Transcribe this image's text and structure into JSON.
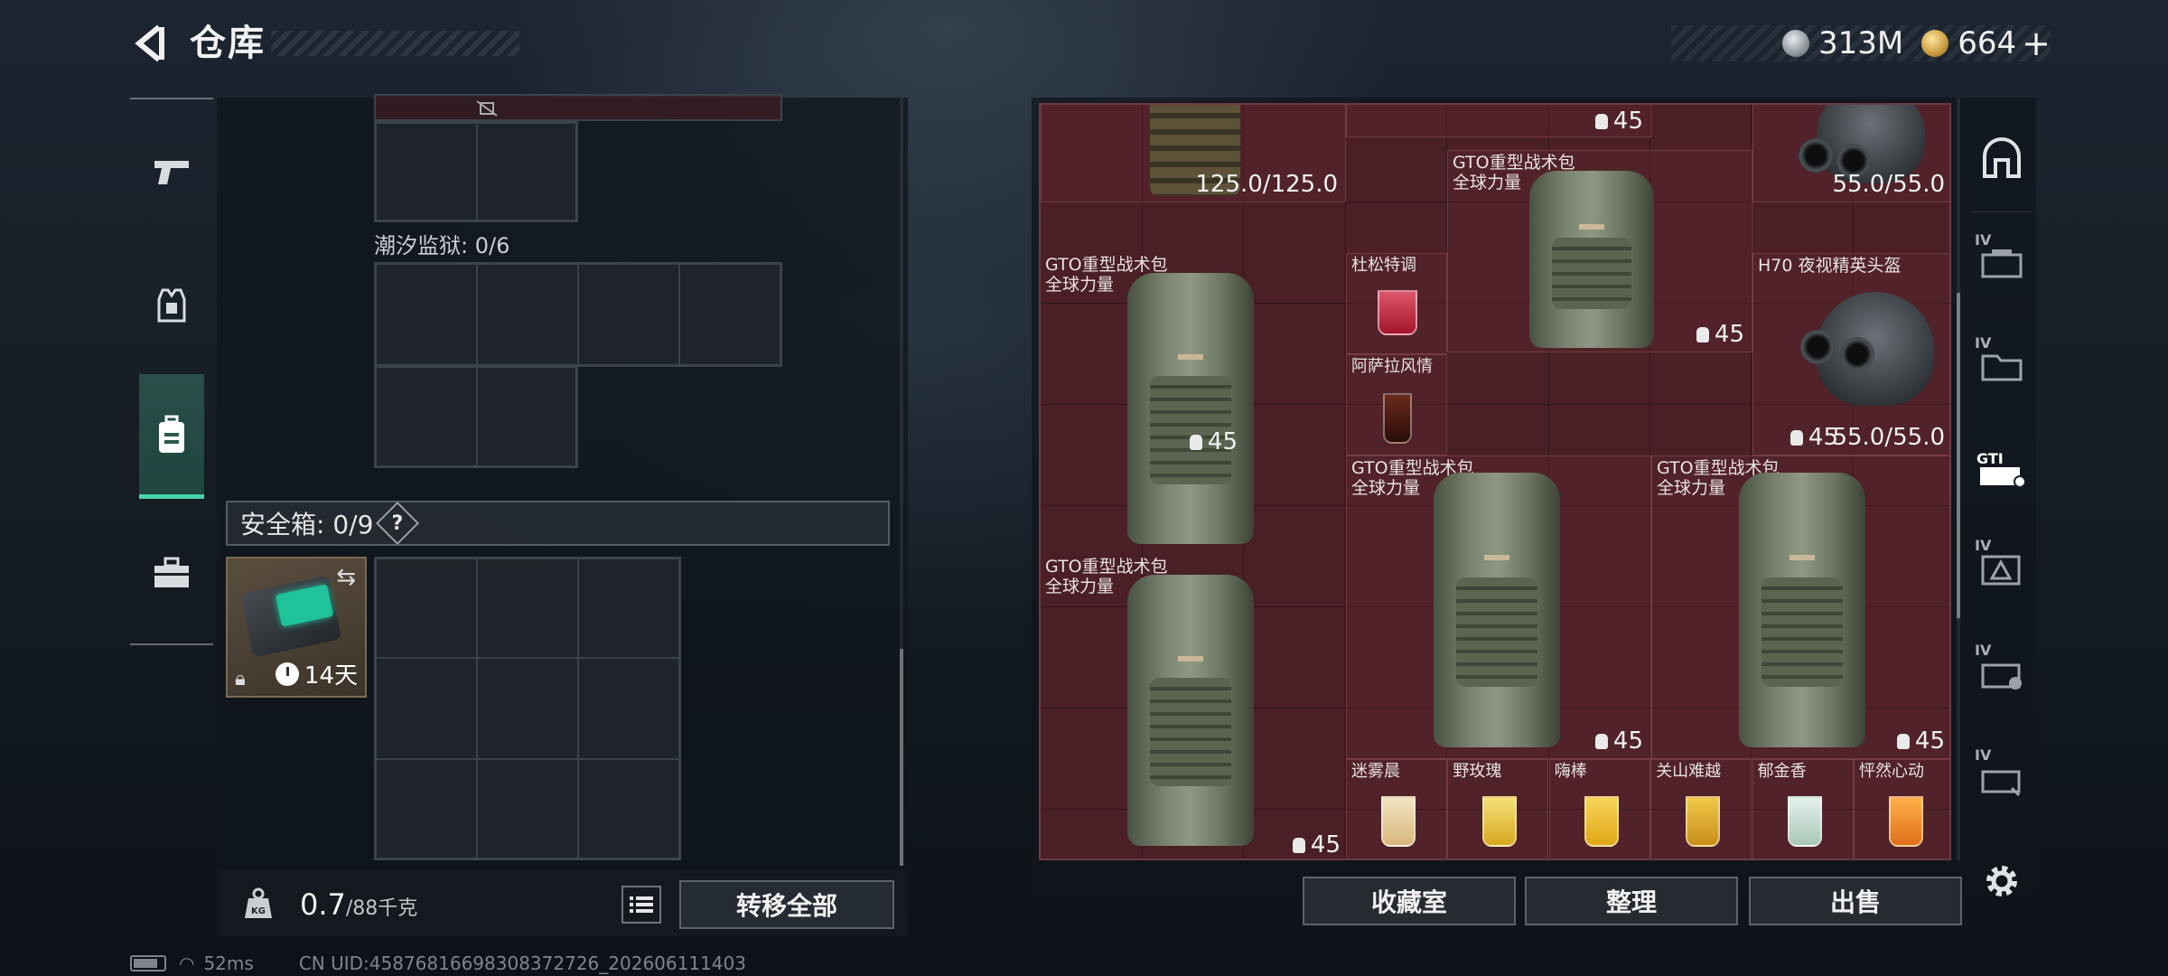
{
  "header": {
    "title": "仓库",
    "currency_silver": "313M",
    "currency_gold": "664",
    "add_label": "+"
  },
  "rail": {
    "items": [
      {
        "name": "weapons",
        "icon": "pistol-icon"
      },
      {
        "name": "gear",
        "icon": "vest-icon"
      },
      {
        "name": "backpack",
        "icon": "backpack-icon",
        "active": true
      },
      {
        "name": "supplies",
        "icon": "briefcase-icon"
      }
    ]
  },
  "left": {
    "container_label": "潮汐监狱: 0/6",
    "safe_label": "安全箱: 0/9",
    "help": "?",
    "safe_timer": "14天",
    "weight_value": "0.7",
    "weight_max": "/88千克",
    "transfer_all": "转移全部"
  },
  "stash": {
    "items": [
      {
        "name": "GTO重型战术包\n全球力量",
        "count": "45"
      },
      {
        "name": "GTO重型战术包\n全球力量",
        "count": "45"
      },
      {
        "name": "GTO重型战术包\n全球力量",
        "count": "45"
      },
      {
        "name": "GTO重型战术包\n全球力量",
        "count": "45"
      },
      {
        "name": "GTO重型战术包\n全球力量",
        "count": "45"
      },
      {
        "name": "H70 夜视精英头盔",
        "durability": "55.0/55.0",
        "count": "45"
      },
      {
        "name": "杜松特调"
      },
      {
        "name": "阿萨拉风情"
      },
      {
        "name": "迷雾晨"
      },
      {
        "name": "野玫瑰"
      },
      {
        "name": "嗨棒"
      },
      {
        "name": "关山难越"
      },
      {
        "name": "郁金香"
      },
      {
        "name": "怦然心动"
      }
    ],
    "top_durability_1": "125.0/125.0",
    "top_durability_2": "55.0/55.0",
    "top_count": "45"
  },
  "actions": {
    "collection": "收藏室",
    "organize": "整理",
    "sell": "出售"
  },
  "side_tabs": {
    "level": "IV"
  },
  "status": {
    "ping": "52ms",
    "uid": "CN UID:45876816698308372726_202606111403"
  },
  "colors": {
    "stash_bg": "#4a1f26",
    "accent": "#46d3a6",
    "panel": "#10161c"
  }
}
